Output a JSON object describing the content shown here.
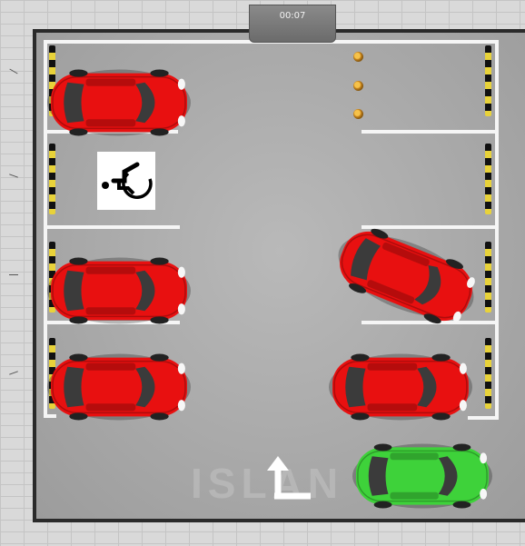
{
  "timer": {
    "text": "00:07"
  },
  "sign": {
    "icon": "wheelchair-icon"
  },
  "watermark": "ISLAN",
  "colors": {
    "parked_car": "#e81010",
    "player_car": "#3ed23a",
    "bollard_stripe": "#e8d23a",
    "cone": "#f2a22a"
  }
}
